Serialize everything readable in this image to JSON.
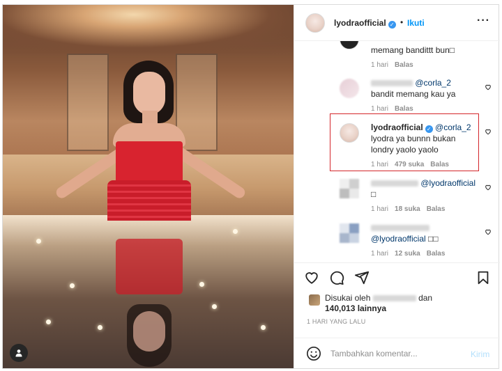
{
  "header": {
    "username": "lyodraofficial",
    "separator": "•",
    "follow_label": "Ikuti",
    "more_label": "···"
  },
  "comments": [
    {
      "text": "memang bandittt bun",
      "tofu": "□",
      "meta": {
        "time": "1 hari",
        "reply": "Balas"
      }
    },
    {
      "mention": "@corla_2",
      "text": "bandit memang kau ya",
      "meta": {
        "time": "1 hari",
        "reply": "Balas"
      }
    },
    {
      "username": "lyodraofficial",
      "mention": "@corla_2",
      "text": "lyodra ya bunnn bukan londry yaolo yaolo",
      "meta": {
        "time": "1 hari",
        "likes": "479 suka",
        "reply": "Balas"
      }
    },
    {
      "mention": "@lyodraofficial",
      "tofu": "□",
      "meta": {
        "time": "1 hari",
        "likes": "18 suka",
        "reply": "Balas"
      }
    },
    {
      "mention": "@lyodraofficial",
      "tofu": "□□",
      "meta": {
        "time": "1 hari",
        "likes": "12 suka",
        "reply": "Balas"
      }
    }
  ],
  "likes": {
    "prefix": "Disukai oleh",
    "and": "dan",
    "count": "140,013 lainnya"
  },
  "date": "1 HARI YANG LALU",
  "add_comment": {
    "placeholder": "Tambahkan komentar...",
    "post_label": "Kirim"
  },
  "colors": {
    "accent": "#0095f6",
    "highlight": "#d4252a",
    "post_disabled": "#b2dffc"
  }
}
